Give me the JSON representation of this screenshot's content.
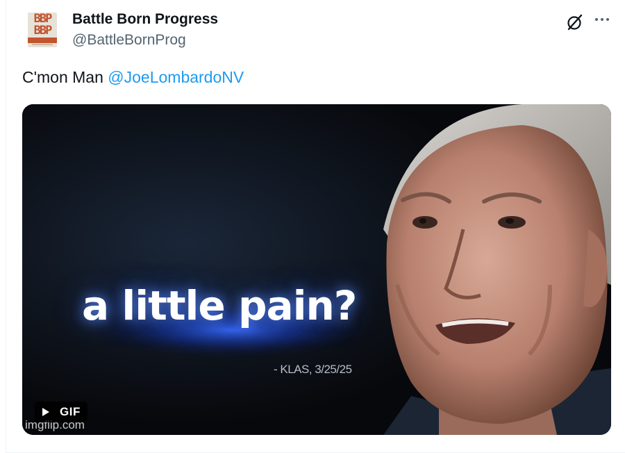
{
  "post": {
    "author_name": "Battle Born Progress",
    "author_handle": "@BattleBornProg",
    "text": "C'mon Man ",
    "mention": "@JoeLombardoNV"
  },
  "avatar": {
    "logo_line1": "BBP",
    "logo_line2": "BBP"
  },
  "icons": {
    "grok": "grok-icon",
    "more": "more-icon",
    "play": "play-icon"
  },
  "media": {
    "caption": "a little pain?",
    "source": "- KLAS, 3/25/25",
    "badge_label": "GIF",
    "watermark": "imgflip.com"
  },
  "colors": {
    "accent": "#1d9bf0",
    "text_primary": "#0f1419",
    "text_secondary": "#536471",
    "logo_orange": "#c2542f"
  }
}
